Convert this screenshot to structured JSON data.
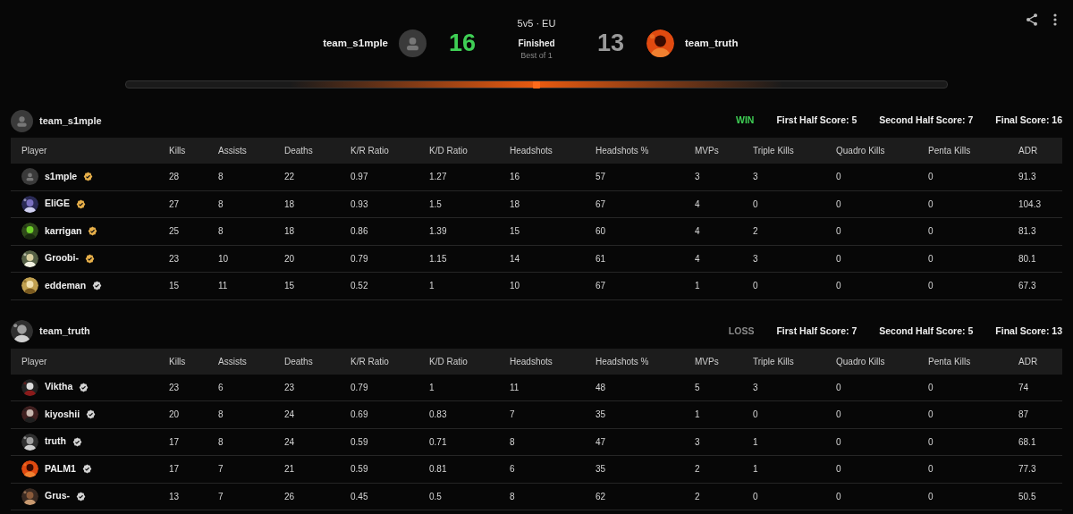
{
  "match": {
    "mode": "5v5 · EU",
    "status": "Finished",
    "format": "Best of 1"
  },
  "teams_header": [
    {
      "name": "team_s1mple",
      "score": "16",
      "winner": true,
      "avatar": {
        "kind": "placeholder"
      }
    },
    {
      "name": "team_truth",
      "score": "13",
      "winner": false,
      "avatar": {
        "kind": "picture"
      }
    }
  ],
  "teams": [
    {
      "name": "team_s1mple",
      "avatar": {
        "kind": "placeholder"
      },
      "result": "WIN",
      "winner": true,
      "first_half": "First Half Score: 5",
      "second_half": "Second Half Score: 7",
      "final": "Final Score: 16",
      "columns": [
        "Player",
        "Kills",
        "Assists",
        "Deaths",
        "K/R Ratio",
        "K/D Ratio",
        "Headshots",
        "Headshots %",
        "MVPs",
        "Triple Kills",
        "Quadro Kills",
        "Penta Kills",
        "ADR"
      ],
      "players": [
        {
          "name": "s1mple",
          "avatar": {
            "kind": "placeholder"
          },
          "color": "#e8b04a",
          "stats": [
            "28",
            "8",
            "22",
            "0.97",
            "1.27",
            "16",
            "57",
            "3",
            "3",
            "0",
            "0",
            "91.3"
          ]
        },
        {
          "name": "EliGE",
          "avatar": {
            "kind": "picture"
          },
          "color": "#e8b04a",
          "stats": [
            "27",
            "8",
            "18",
            "0.93",
            "1.5",
            "18",
            "67",
            "4",
            "0",
            "0",
            "0",
            "104.3"
          ]
        },
        {
          "name": "karrigan",
          "avatar": {
            "kind": "picture"
          },
          "color": "#e8b04a",
          "stats": [
            "25",
            "8",
            "18",
            "0.86",
            "1.39",
            "15",
            "60",
            "4",
            "2",
            "0",
            "0",
            "81.3"
          ]
        },
        {
          "name": "Groobi-",
          "avatar": {
            "kind": "picture"
          },
          "color": "#e8b04a",
          "stats": [
            "23",
            "10",
            "20",
            "0.79",
            "1.15",
            "14",
            "61",
            "4",
            "3",
            "0",
            "0",
            "80.1"
          ]
        },
        {
          "name": "eddeman",
          "avatar": {
            "kind": "picture"
          },
          "color": "#d4d4d4",
          "stats": [
            "15",
            "11",
            "15",
            "0.52",
            "1",
            "10",
            "67",
            "1",
            "0",
            "0",
            "0",
            "67.3"
          ]
        }
      ]
    },
    {
      "name": "team_truth",
      "avatar": {
        "kind": "picture"
      },
      "result": "LOSS",
      "winner": false,
      "first_half": "First Half Score: 7",
      "second_half": "Second Half Score: 5",
      "final": "Final Score: 13",
      "columns": [
        "Player",
        "Kills",
        "Assists",
        "Deaths",
        "K/R Ratio",
        "K/D Ratio",
        "Headshots",
        "Headshots %",
        "MVPs",
        "Triple Kills",
        "Quadro Kills",
        "Penta Kills",
        "ADR"
      ],
      "players": [
        {
          "name": "Viktha",
          "avatar": {
            "kind": "picture"
          },
          "color": "#d4d4d4",
          "stats": [
            "23",
            "6",
            "23",
            "0.79",
            "1",
            "11",
            "48",
            "5",
            "3",
            "0",
            "0",
            "74"
          ]
        },
        {
          "name": "kiyoshii",
          "avatar": {
            "kind": "picture"
          },
          "color": "#d4d4d4",
          "stats": [
            "20",
            "8",
            "24",
            "0.69",
            "0.83",
            "7",
            "35",
            "1",
            "0",
            "0",
            "0",
            "87"
          ]
        },
        {
          "name": "truth",
          "avatar": {
            "kind": "picture"
          },
          "color": "#d4d4d4",
          "stats": [
            "17",
            "8",
            "24",
            "0.59",
            "0.71",
            "8",
            "47",
            "3",
            "1",
            "0",
            "0",
            "68.1"
          ]
        },
        {
          "name": "PALM1",
          "avatar": {
            "kind": "picture"
          },
          "color": "#d4d4d4",
          "stats": [
            "17",
            "7",
            "21",
            "0.59",
            "0.81",
            "6",
            "35",
            "2",
            "1",
            "0",
            "0",
            "77.3"
          ]
        },
        {
          "name": "Grus-",
          "avatar": {
            "kind": "picture"
          },
          "color": "#d4d4d4",
          "stats": [
            "13",
            "7",
            "26",
            "0.45",
            "0.5",
            "8",
            "62",
            "2",
            "0",
            "0",
            "0",
            "50.5"
          ]
        }
      ]
    }
  ]
}
